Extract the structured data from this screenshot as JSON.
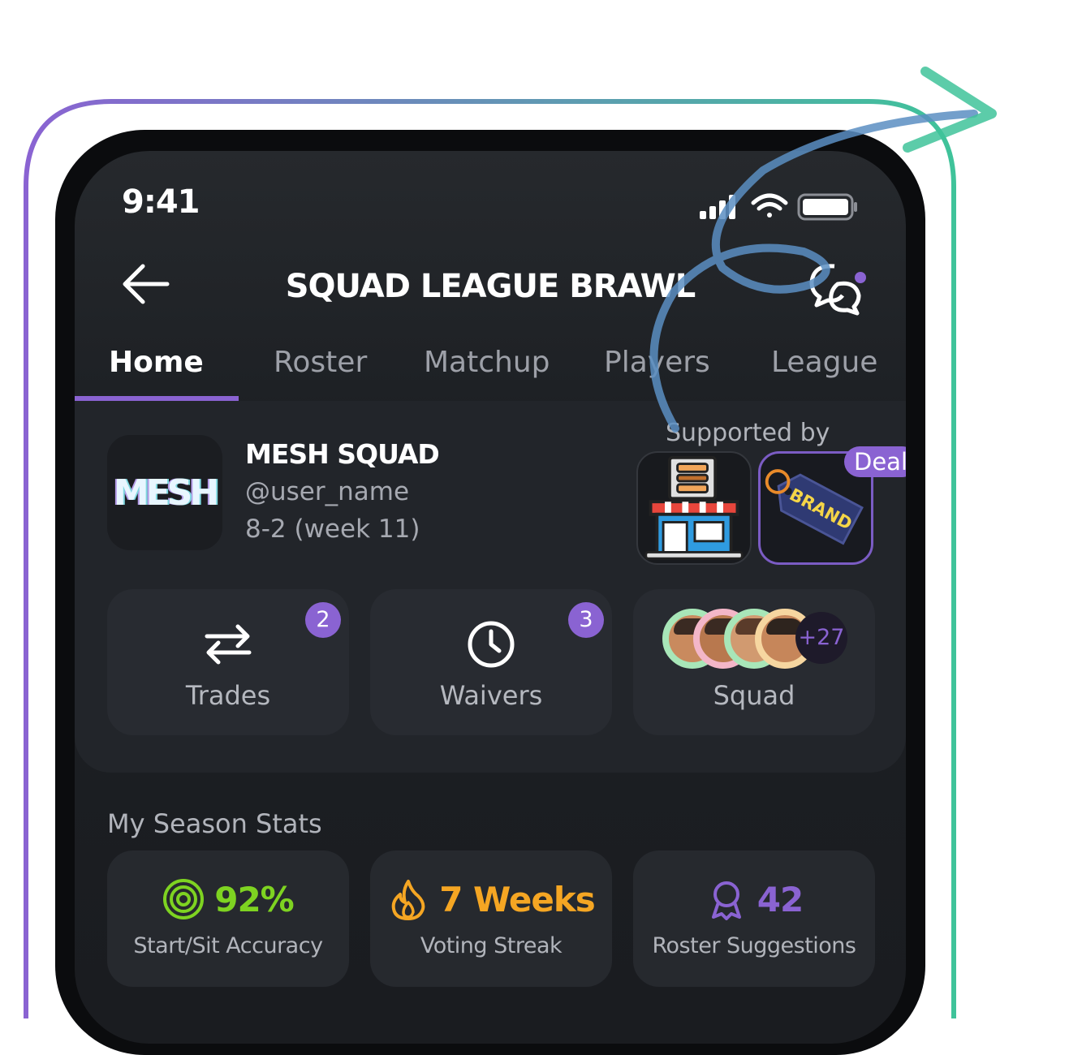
{
  "status_bar": {
    "time": "9:41"
  },
  "header": {
    "title": "SQUAD LEAGUE BRAWL"
  },
  "tabs": [
    {
      "label": "Home",
      "active": true
    },
    {
      "label": "Roster",
      "active": false
    },
    {
      "label": "Matchup",
      "active": false
    },
    {
      "label": "Players",
      "active": false
    },
    {
      "label": "League",
      "active": false
    }
  ],
  "team": {
    "logo_text": "MESH",
    "name": "MESH SQUAD",
    "username": "@user_name",
    "record": "8-2 (week 11)"
  },
  "sponsors": {
    "label": "Supported by",
    "brand_tag_text": "BRAND",
    "deal_badge": "Deal"
  },
  "actions": [
    {
      "label": "Trades",
      "badge": "2",
      "icon": "swap-arrows-icon"
    },
    {
      "label": "Waivers",
      "badge": "3",
      "icon": "clock-icon"
    },
    {
      "label": "Squad",
      "more_count": "+27",
      "icon": "avatar-stack"
    }
  ],
  "season_stats": {
    "title": "My Season Stats",
    "items": [
      {
        "value": "92%",
        "label": "Start/Sit Accuracy",
        "color": "#7ed321",
        "icon": "target-icon"
      },
      {
        "value": "7 Weeks",
        "label": "Voting Streak",
        "color": "#f5a623",
        "icon": "flame-icon"
      },
      {
        "value": "42",
        "label": "Roster Suggestions",
        "color": "#8a63d2",
        "icon": "award-ribbon-icon"
      }
    ]
  },
  "colors": {
    "accent": "#8a63d2",
    "frame_gradient_start": "#8a63d2",
    "frame_gradient_end": "#3fc39a",
    "background": "#1d2024"
  }
}
